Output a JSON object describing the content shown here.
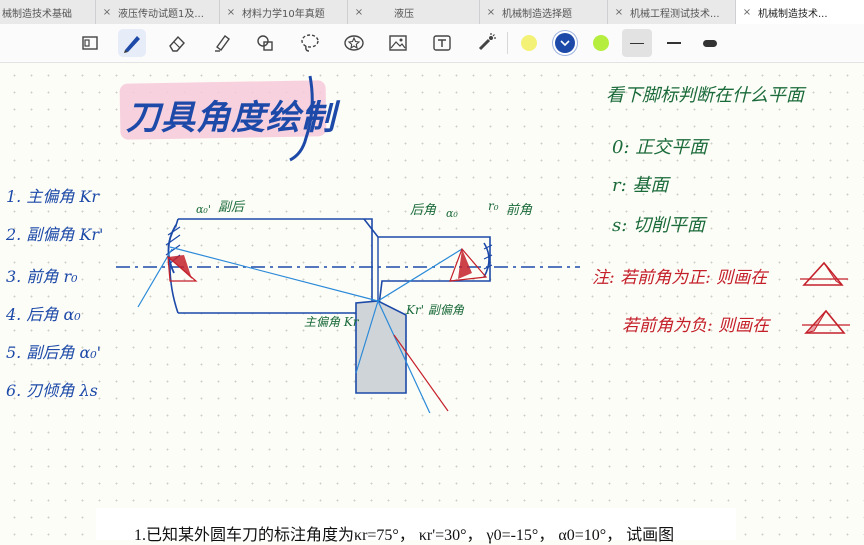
{
  "tabs": [
    {
      "label": "械制造技术基础",
      "close": ""
    },
    {
      "label": "液压传动试题1及...",
      "close": "×"
    },
    {
      "label": "材料力学10年真题",
      "close": "×"
    },
    {
      "label": "液压",
      "close": "×"
    },
    {
      "label": "机械制造选择题",
      "close": "×"
    },
    {
      "label": "机械工程测试技术...",
      "close": "×"
    },
    {
      "label": "机械制造技术...",
      "close": "×"
    }
  ],
  "toolbar": {
    "tools": [
      "page-view-icon",
      "pen-icon",
      "eraser-icon",
      "highlighter-icon",
      "shapes-icon",
      "lasso-icon",
      "star-sticker-icon",
      "image-icon",
      "text-box-icon",
      "laser-pointer-icon"
    ],
    "colors": [
      "#f4f276",
      "#1d4aa8",
      "#b5ee3e"
    ],
    "selected_color": "#1d4aa8",
    "stroke_widths": [
      "thin",
      "medium",
      "thick"
    ]
  },
  "note": {
    "title": "刀具角度绘制",
    "angle_list": [
      "1. 主偏角 Kr",
      "2. 副偏角 Kr'",
      "3. 前角 r₀",
      "4. 后角 α₀",
      "5. 副后角 α₀'",
      "6. 刃倾角 λs"
    ],
    "plane_header": "看下脚标判断在什么平面",
    "planes": [
      "0: 正交平面",
      "r: 基面",
      "s: 切削平面"
    ],
    "notes": [
      "注: 若前角为正: 则画在",
      "若前角为负: 则画在"
    ],
    "diagram_labels": {
      "side_clearance": "副后",
      "side_clearance_symbol": "α₀'",
      "clearance": "后角",
      "clearance_symbol": "α₀",
      "rake_symbol": "r₀",
      "rake": "前角",
      "main_cutting": "主偏角 Kr",
      "minor_cutting": "Kr' 副偏角"
    },
    "question": "1.已知某外圆车刀的标注角度为κr=75°， κr'=30°， γ0=-15°， α0=10°， 试画图"
  }
}
